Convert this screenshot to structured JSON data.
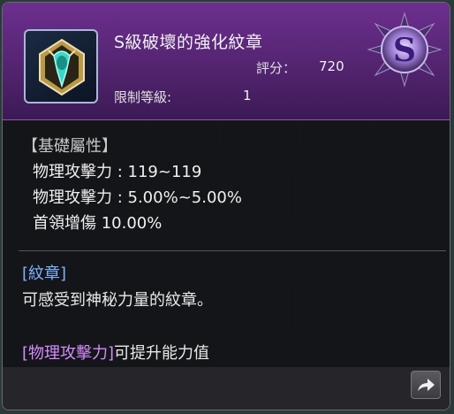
{
  "item": {
    "title": "S級破壞的強化紋章",
    "score_label": "評分：",
    "score_value": "720",
    "level_label": "限制等級:",
    "level_value": "1",
    "grade_letter": "S"
  },
  "base_stats": {
    "header": "【基礎屬性】",
    "rows": [
      "物理攻擊力 : 119~119",
      "物理攻擊力 : 5.00%~5.00%",
      "首領增傷 10.00%"
    ]
  },
  "description": {
    "tag": "[紋章]",
    "text": "可感受到神秘力量的紋章。",
    "stat_tag": "[物理攻擊力]",
    "stat_text": "可提升能力值"
  },
  "colors": {
    "header_purple": "#6d2f8f",
    "tag_blue": "#7fb2ff",
    "tag_purple": "#d58cff"
  },
  "icons": [
    "emblem-icon",
    "grade-s-badge-icon",
    "share-arrow-icon"
  ]
}
